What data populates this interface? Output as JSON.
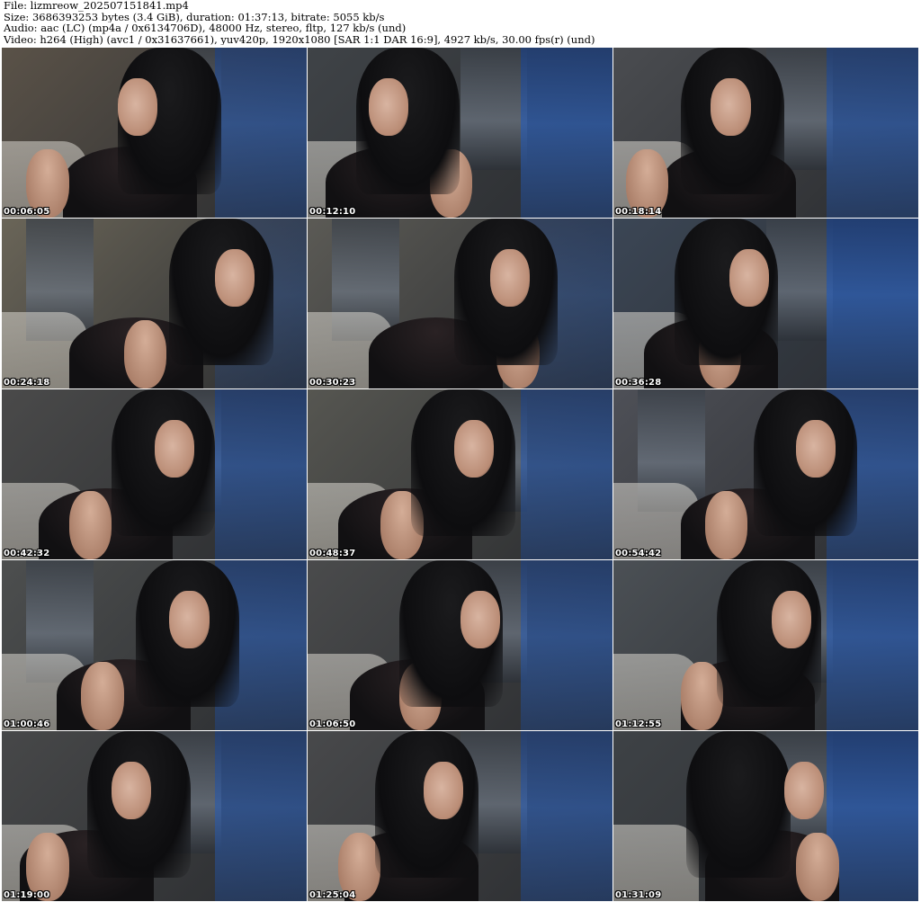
{
  "header": {
    "file_line": "File: lizmreow_202507151841.mp4",
    "size_line": "Size: 3686393253 bytes (3.4 GiB), duration: 01:37:13, bitrate: 5055 kb/s",
    "audio_line": "Audio: aac (LC) (mp4a / 0x6134706D), 48000 Hz, stereo, fltp, 127 kb/s (und)",
    "video_line": "Video: h264 (High) (avc1 / 0x31637661), yuv420p, 1920x1080 [SAR 1:1 DAR 16:9], 4927 kb/s, 30.00 fps(r) (und)"
  },
  "thumbnails": [
    {
      "timestamp": "00:06:05"
    },
    {
      "timestamp": "00:12:10"
    },
    {
      "timestamp": "00:18:14"
    },
    {
      "timestamp": "00:24:18"
    },
    {
      "timestamp": "00:30:23"
    },
    {
      "timestamp": "00:36:28"
    },
    {
      "timestamp": "00:42:32"
    },
    {
      "timestamp": "00:48:37"
    },
    {
      "timestamp": "00:54:42"
    },
    {
      "timestamp": "01:00:46"
    },
    {
      "timestamp": "01:06:50"
    },
    {
      "timestamp": "01:12:55"
    },
    {
      "timestamp": "01:19:00"
    },
    {
      "timestamp": "01:25:04"
    },
    {
      "timestamp": "01:31:09"
    }
  ],
  "colors": {
    "background": "#ffffff",
    "timestamp_text": "#ffffff",
    "timestamp_outline": "#000000"
  }
}
